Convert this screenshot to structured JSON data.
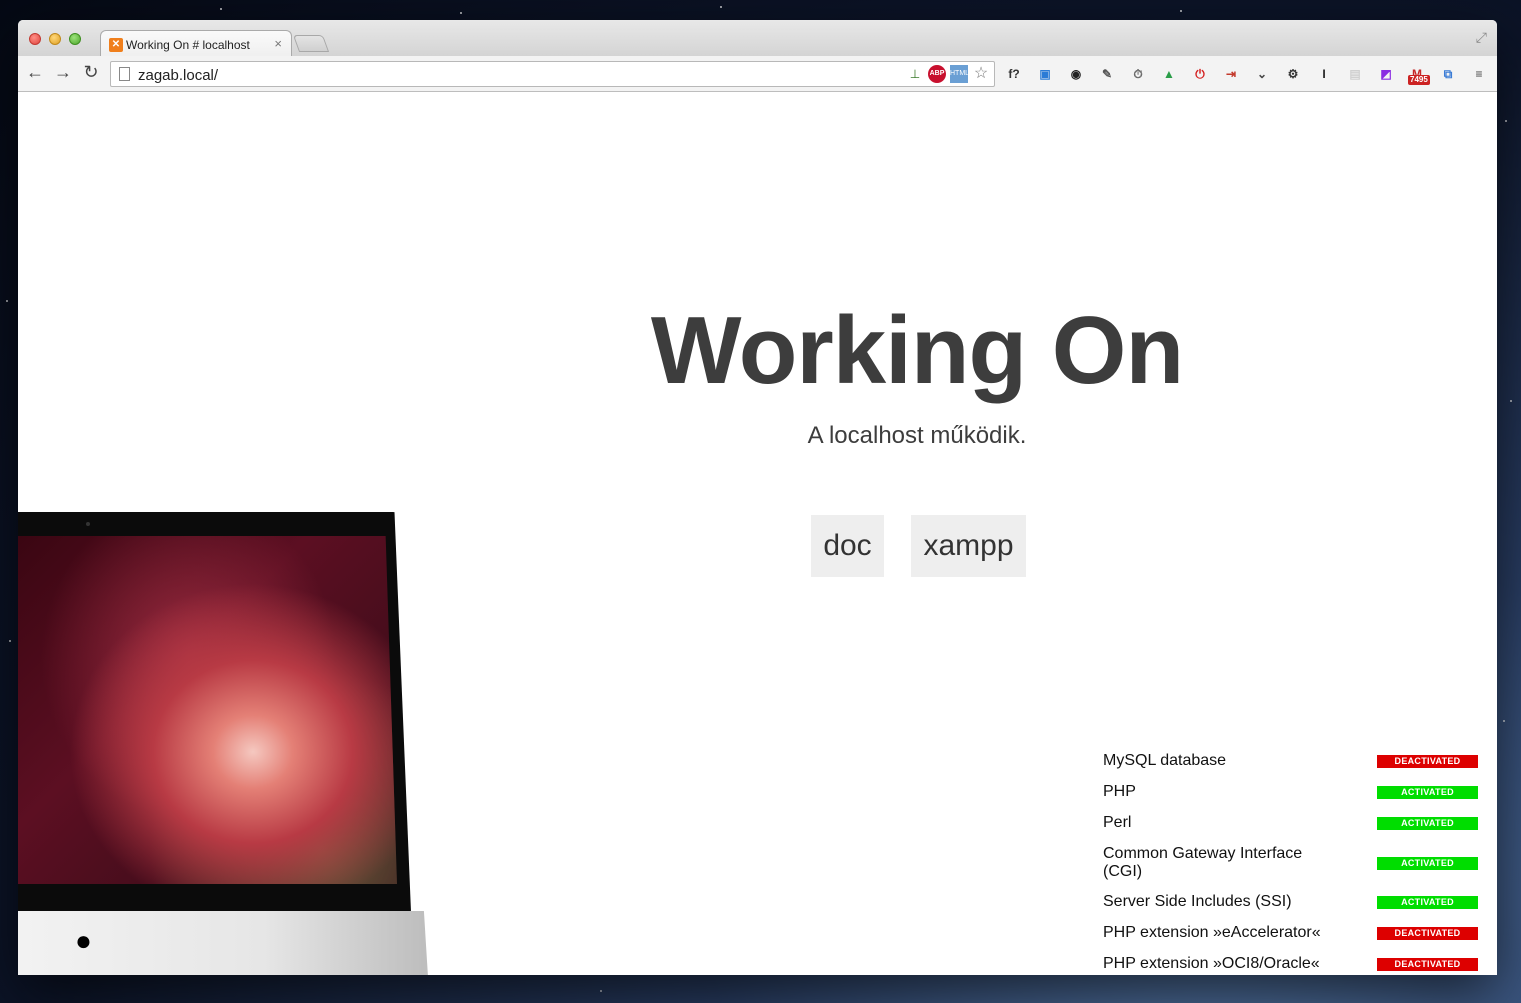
{
  "browser": {
    "tab_title": "Working On # localhost",
    "tab_favicon": "✕",
    "tab_close": "×",
    "url": "zagab.local/",
    "nav": {
      "back": "←",
      "forward": "→",
      "reload": "↻"
    },
    "omnibox_icons": [
      "download-arrow-icon",
      "abp-icon",
      "html-icon",
      "bookmark-star-icon"
    ],
    "extensions": [
      {
        "name": "fx-icon",
        "glyph": "f?",
        "color": "#333333"
      },
      {
        "name": "screen-capture-icon",
        "glyph": "▣",
        "color": "#2b7bd6"
      },
      {
        "name": "color-wheel-icon",
        "glyph": "◉",
        "color": "#222222"
      },
      {
        "name": "eyedropper-icon",
        "glyph": "✎",
        "color": "#555555"
      },
      {
        "name": "timer-icon",
        "glyph": "⏱",
        "color": "#666666"
      },
      {
        "name": "google-drive-icon",
        "glyph": "▲",
        "color": "#2a9d48"
      },
      {
        "name": "stop-icon",
        "glyph": "⏻",
        "color": "#d42020"
      },
      {
        "name": "exit-icon",
        "glyph": "⇥",
        "color": "#c33a2c"
      },
      {
        "name": "pocket-icon",
        "glyph": "⌄",
        "color": "#444444"
      },
      {
        "name": "gear-icon",
        "glyph": "⚙",
        "color": "#333333"
      },
      {
        "name": "instapaper-icon",
        "glyph": "I",
        "color": "#222222"
      },
      {
        "name": "calendar-icon",
        "glyph": "▤",
        "color": "#d0d0d0"
      },
      {
        "name": "rainbow-icon",
        "glyph": "◩",
        "color": "#8a2be2"
      },
      {
        "name": "gmail-icon",
        "glyph": "M",
        "color": "#c62828",
        "badge": "7495"
      },
      {
        "name": "window-resize-icon",
        "glyph": "⧉",
        "color": "#3a7bd5"
      },
      {
        "name": "menu-icon",
        "glyph": "≡",
        "color": "#444444"
      }
    ]
  },
  "page": {
    "title": "Working On",
    "subtitle": "A localhost működik.",
    "buttons": {
      "doc": "doc",
      "xampp": "xampp"
    },
    "apple_logo": ""
  },
  "status": {
    "colors": {
      "activated": "#00dd00",
      "deactivated": "#dd0000"
    },
    "items": [
      {
        "label": "MySQL database",
        "state": "DEACTIVATED"
      },
      {
        "label": "PHP",
        "state": "ACTIVATED"
      },
      {
        "label": "Perl",
        "state": "ACTIVATED"
      },
      {
        "label": "Common Gateway Interface (CGI)",
        "state": "ACTIVATED"
      },
      {
        "label": "Server Side Includes (SSI)",
        "state": "ACTIVATED"
      },
      {
        "label": "PHP extension »eAccelerator«",
        "state": "DEACTIVATED"
      },
      {
        "label": "PHP extension »OCI8/Oracle«",
        "state": "DEACTIVATED"
      }
    ]
  }
}
